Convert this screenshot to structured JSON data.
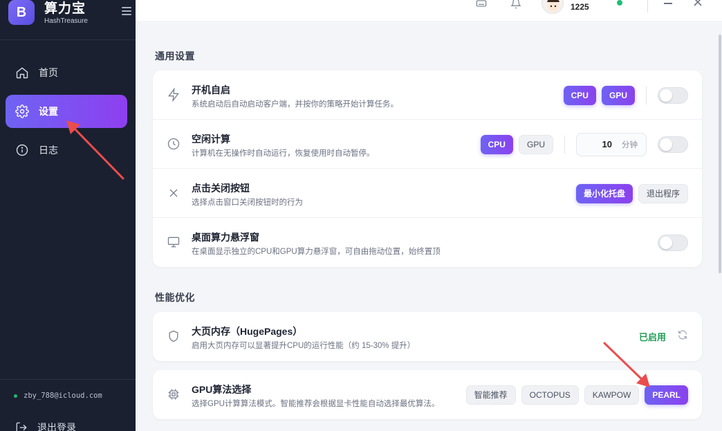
{
  "app": {
    "name": "算力宝",
    "subtitle": "HashTreasure",
    "logo_letter": "B"
  },
  "nav": {
    "items": [
      {
        "label": "首页",
        "icon": "home-icon",
        "active": false
      },
      {
        "label": "设置",
        "icon": "gear-icon",
        "active": true
      },
      {
        "label": "日志",
        "icon": "info-icon",
        "active": false
      }
    ]
  },
  "account": {
    "email": "zby_788@icloud.com",
    "status_color": "#24b86a"
  },
  "logout_label": "退出登录",
  "topbar": {
    "user_number": "1225",
    "online_color": "#1fbf74"
  },
  "sections": {
    "general": {
      "title": "通用设置"
    },
    "performance": {
      "title": "性能优化"
    }
  },
  "general_rows": {
    "autostart": {
      "title": "开机自启",
      "desc": "系统启动后自动启动客户端，并按你的策略开始计算任务。",
      "cpu": "CPU",
      "gpu": "GPU"
    },
    "idle": {
      "title": "空闲计算",
      "desc": "计算机在无操作时自动运行，恢复使用时自动暂停。",
      "cpu": "CPU",
      "gpu": "GPU",
      "minutes": "10",
      "unit": "分钟"
    },
    "close_btn": {
      "title": "点击关闭按钮",
      "desc": "选择点击窗口关闭按钮时的行为",
      "opt_tray": "最小化托盘",
      "opt_exit": "退出程序"
    },
    "float": {
      "title": "桌面算力悬浮窗",
      "desc": "在桌面显示独立的CPU和GPU算力悬浮窗，可自由拖动位置，始终置顶"
    }
  },
  "perf_rows": {
    "hugepages": {
      "title": "大页内存（HugePages）",
      "desc": "启用大页内存可以显著提升CPU的运行性能（约 15-30% 提升）",
      "status": "已启用"
    },
    "gpu_algo": {
      "title": "GPU算法选择",
      "desc": "选择GPU计算算法模式。智能推荐会根据显卡性能自动选择最优算法。",
      "options": [
        "智能推荐",
        "OCTOPUS",
        "KAWPOW",
        "PEARL"
      ],
      "selected": "PEARL"
    }
  },
  "colors": {
    "accent_start": "#6e63f3",
    "accent_end": "#8b41ee",
    "annotation_arrow": "#ea4d4d",
    "sidebar_bg": "#1a2030"
  }
}
